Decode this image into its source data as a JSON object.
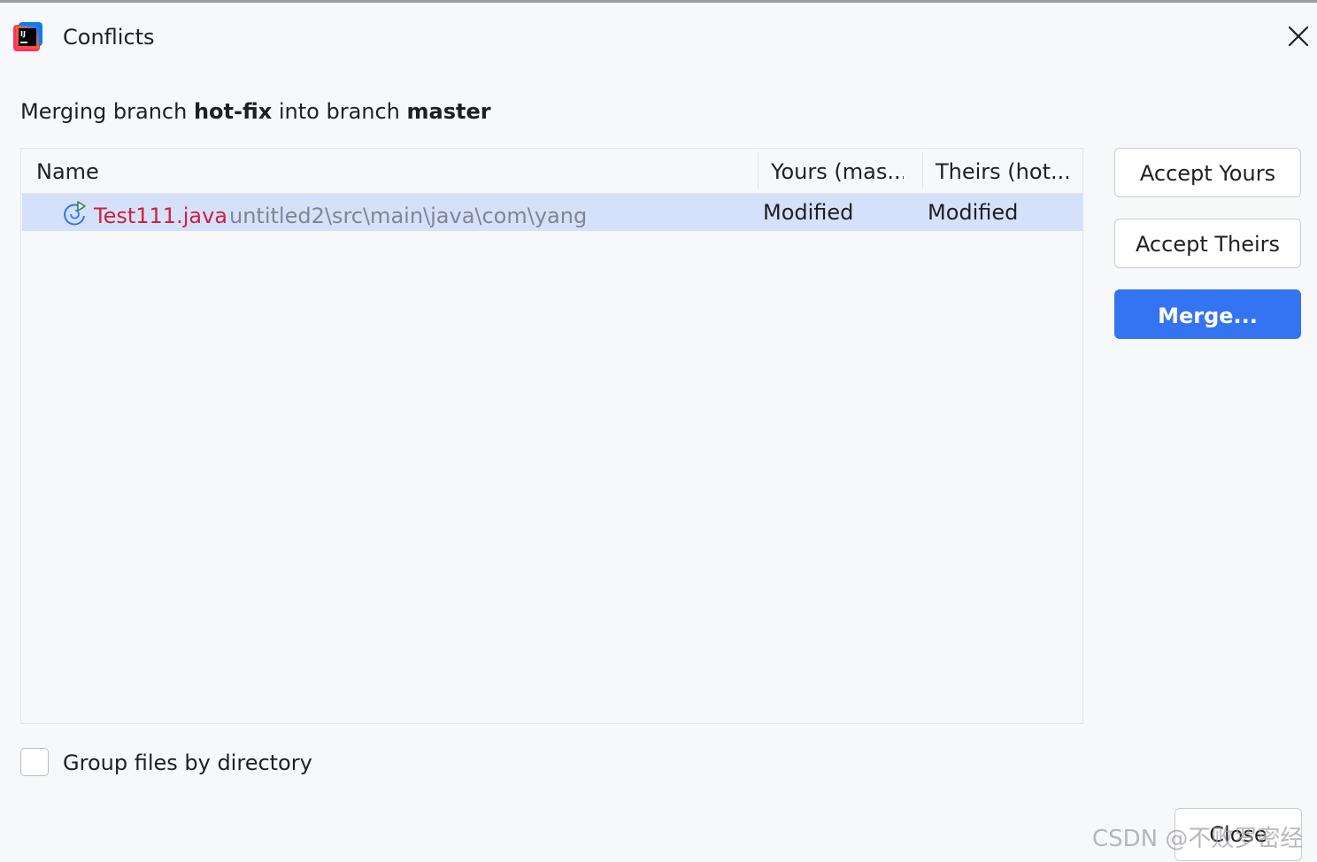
{
  "dialog": {
    "title": "Conflicts",
    "close_icon": "close-icon",
    "app_icon": "intellij-idea-icon"
  },
  "subtitle": {
    "prefix": "Merging branch ",
    "source_branch": "hot-fix",
    "middle": " into branch ",
    "target_branch": "master"
  },
  "table": {
    "columns": [
      "Name",
      "Yours (mas...",
      "Theirs (hot..."
    ],
    "rows": [
      {
        "icon": "conflict-refresh-icon",
        "file": "Test111.java",
        "path": "untitled2\\src\\main\\java\\com\\yang",
        "yours": "Modified",
        "theirs": "Modified",
        "selected": true
      }
    ]
  },
  "actions": {
    "accept_yours": "Accept Yours",
    "accept_theirs": "Accept Theirs",
    "merge": "Merge..."
  },
  "options": {
    "group_by_directory_label": "Group files by directory",
    "group_by_directory_checked": false
  },
  "footer": {
    "close": "Close"
  },
  "watermark": "CSDN @不败罗密经",
  "colors": {
    "background": "#f7f8fa",
    "selected_row": "#d5e1fb",
    "conflict_file": "#d1203a",
    "path_text": "#818594",
    "primary_button": "#3574f0"
  }
}
